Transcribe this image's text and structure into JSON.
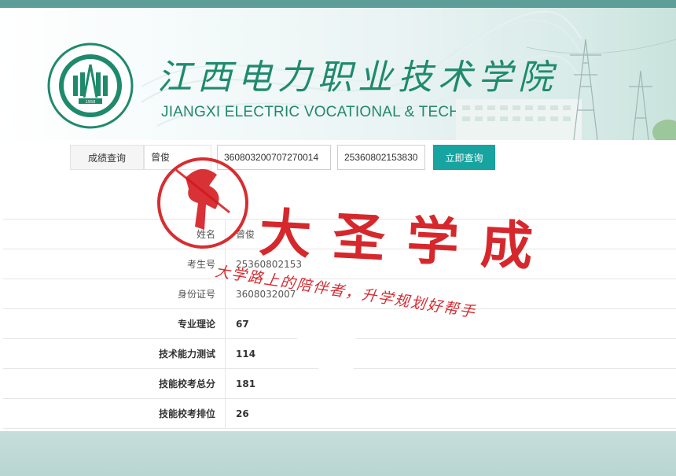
{
  "banner": {
    "title_cn": "江西电力职业技术学院",
    "title_en": "JIANGXI ELECTRIC VOCATIONAL & TECHNICAL COLLEGE",
    "logo_year": "1958",
    "logo_ring_text": "JIANGXI ELECTRIC VOCATIONAL & TECHNICAL COLLEGE",
    "logo_top_text": "江西电力职业技术学院"
  },
  "query": {
    "label": "成绩查询",
    "name_value": "曾俊",
    "id_value": "360803200707270014",
    "exam_no_value": "25360802153830",
    "submit_label": "立即查询"
  },
  "results": {
    "rows": [
      {
        "key": "姓名",
        "value": "曾俊"
      },
      {
        "key": "考生号",
        "value": "25360802153"
      },
      {
        "key": "身份证号",
        "value": "3608032007"
      },
      {
        "key": "专业理论",
        "value": "67"
      },
      {
        "key": "技术能力测试",
        "value": "114"
      },
      {
        "key": "技能校考总分",
        "value": "181"
      },
      {
        "key": "技能校考排位",
        "value": "26"
      }
    ]
  },
  "watermark": {
    "brand": "大圣学成",
    "slogan": "大学路上的陪伴者，升学规划好帮手"
  },
  "colors": {
    "accent": "#17a3a0",
    "topbar": "#5e9e98",
    "brand_green": "#1f8a6e",
    "stamp_red": "#d3161b"
  }
}
